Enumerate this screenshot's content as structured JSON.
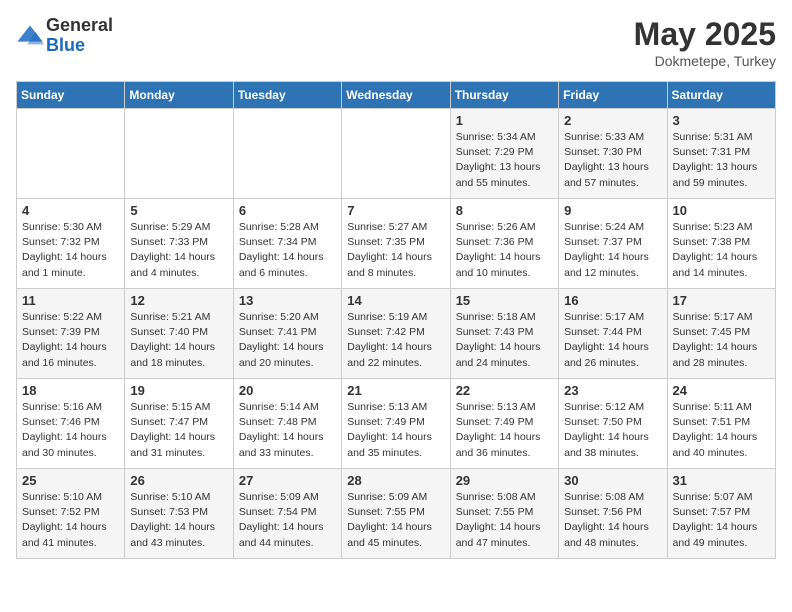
{
  "logo": {
    "general": "General",
    "blue": "Blue"
  },
  "title": "May 2025",
  "subtitle": "Dokmetepe, Turkey",
  "days_of_week": [
    "Sunday",
    "Monday",
    "Tuesday",
    "Wednesday",
    "Thursday",
    "Friday",
    "Saturday"
  ],
  "weeks": [
    [
      {
        "day": "",
        "info": ""
      },
      {
        "day": "",
        "info": ""
      },
      {
        "day": "",
        "info": ""
      },
      {
        "day": "",
        "info": ""
      },
      {
        "day": "1",
        "sunrise": "Sunrise: 5:34 AM",
        "sunset": "Sunset: 7:29 PM",
        "daylight": "Daylight: 13 hours and 55 minutes."
      },
      {
        "day": "2",
        "sunrise": "Sunrise: 5:33 AM",
        "sunset": "Sunset: 7:30 PM",
        "daylight": "Daylight: 13 hours and 57 minutes."
      },
      {
        "day": "3",
        "sunrise": "Sunrise: 5:31 AM",
        "sunset": "Sunset: 7:31 PM",
        "daylight": "Daylight: 13 hours and 59 minutes."
      }
    ],
    [
      {
        "day": "4",
        "sunrise": "Sunrise: 5:30 AM",
        "sunset": "Sunset: 7:32 PM",
        "daylight": "Daylight: 14 hours and 1 minute."
      },
      {
        "day": "5",
        "sunrise": "Sunrise: 5:29 AM",
        "sunset": "Sunset: 7:33 PM",
        "daylight": "Daylight: 14 hours and 4 minutes."
      },
      {
        "day": "6",
        "sunrise": "Sunrise: 5:28 AM",
        "sunset": "Sunset: 7:34 PM",
        "daylight": "Daylight: 14 hours and 6 minutes."
      },
      {
        "day": "7",
        "sunrise": "Sunrise: 5:27 AM",
        "sunset": "Sunset: 7:35 PM",
        "daylight": "Daylight: 14 hours and 8 minutes."
      },
      {
        "day": "8",
        "sunrise": "Sunrise: 5:26 AM",
        "sunset": "Sunset: 7:36 PM",
        "daylight": "Daylight: 14 hours and 10 minutes."
      },
      {
        "day": "9",
        "sunrise": "Sunrise: 5:24 AM",
        "sunset": "Sunset: 7:37 PM",
        "daylight": "Daylight: 14 hours and 12 minutes."
      },
      {
        "day": "10",
        "sunrise": "Sunrise: 5:23 AM",
        "sunset": "Sunset: 7:38 PM",
        "daylight": "Daylight: 14 hours and 14 minutes."
      }
    ],
    [
      {
        "day": "11",
        "sunrise": "Sunrise: 5:22 AM",
        "sunset": "Sunset: 7:39 PM",
        "daylight": "Daylight: 14 hours and 16 minutes."
      },
      {
        "day": "12",
        "sunrise": "Sunrise: 5:21 AM",
        "sunset": "Sunset: 7:40 PM",
        "daylight": "Daylight: 14 hours and 18 minutes."
      },
      {
        "day": "13",
        "sunrise": "Sunrise: 5:20 AM",
        "sunset": "Sunset: 7:41 PM",
        "daylight": "Daylight: 14 hours and 20 minutes."
      },
      {
        "day": "14",
        "sunrise": "Sunrise: 5:19 AM",
        "sunset": "Sunset: 7:42 PM",
        "daylight": "Daylight: 14 hours and 22 minutes."
      },
      {
        "day": "15",
        "sunrise": "Sunrise: 5:18 AM",
        "sunset": "Sunset: 7:43 PM",
        "daylight": "Daylight: 14 hours and 24 minutes."
      },
      {
        "day": "16",
        "sunrise": "Sunrise: 5:17 AM",
        "sunset": "Sunset: 7:44 PM",
        "daylight": "Daylight: 14 hours and 26 minutes."
      },
      {
        "day": "17",
        "sunrise": "Sunrise: 5:17 AM",
        "sunset": "Sunset: 7:45 PM",
        "daylight": "Daylight: 14 hours and 28 minutes."
      }
    ],
    [
      {
        "day": "18",
        "sunrise": "Sunrise: 5:16 AM",
        "sunset": "Sunset: 7:46 PM",
        "daylight": "Daylight: 14 hours and 30 minutes."
      },
      {
        "day": "19",
        "sunrise": "Sunrise: 5:15 AM",
        "sunset": "Sunset: 7:47 PM",
        "daylight": "Daylight: 14 hours and 31 minutes."
      },
      {
        "day": "20",
        "sunrise": "Sunrise: 5:14 AM",
        "sunset": "Sunset: 7:48 PM",
        "daylight": "Daylight: 14 hours and 33 minutes."
      },
      {
        "day": "21",
        "sunrise": "Sunrise: 5:13 AM",
        "sunset": "Sunset: 7:49 PM",
        "daylight": "Daylight: 14 hours and 35 minutes."
      },
      {
        "day": "22",
        "sunrise": "Sunrise: 5:13 AM",
        "sunset": "Sunset: 7:49 PM",
        "daylight": "Daylight: 14 hours and 36 minutes."
      },
      {
        "day": "23",
        "sunrise": "Sunrise: 5:12 AM",
        "sunset": "Sunset: 7:50 PM",
        "daylight": "Daylight: 14 hours and 38 minutes."
      },
      {
        "day": "24",
        "sunrise": "Sunrise: 5:11 AM",
        "sunset": "Sunset: 7:51 PM",
        "daylight": "Daylight: 14 hours and 40 minutes."
      }
    ],
    [
      {
        "day": "25",
        "sunrise": "Sunrise: 5:10 AM",
        "sunset": "Sunset: 7:52 PM",
        "daylight": "Daylight: 14 hours and 41 minutes."
      },
      {
        "day": "26",
        "sunrise": "Sunrise: 5:10 AM",
        "sunset": "Sunset: 7:53 PM",
        "daylight": "Daylight: 14 hours and 43 minutes."
      },
      {
        "day": "27",
        "sunrise": "Sunrise: 5:09 AM",
        "sunset": "Sunset: 7:54 PM",
        "daylight": "Daylight: 14 hours and 44 minutes."
      },
      {
        "day": "28",
        "sunrise": "Sunrise: 5:09 AM",
        "sunset": "Sunset: 7:55 PM",
        "daylight": "Daylight: 14 hours and 45 minutes."
      },
      {
        "day": "29",
        "sunrise": "Sunrise: 5:08 AM",
        "sunset": "Sunset: 7:55 PM",
        "daylight": "Daylight: 14 hours and 47 minutes."
      },
      {
        "day": "30",
        "sunrise": "Sunrise: 5:08 AM",
        "sunset": "Sunset: 7:56 PM",
        "daylight": "Daylight: 14 hours and 48 minutes."
      },
      {
        "day": "31",
        "sunrise": "Sunrise: 5:07 AM",
        "sunset": "Sunset: 7:57 PM",
        "daylight": "Daylight: 14 hours and 49 minutes."
      }
    ]
  ]
}
